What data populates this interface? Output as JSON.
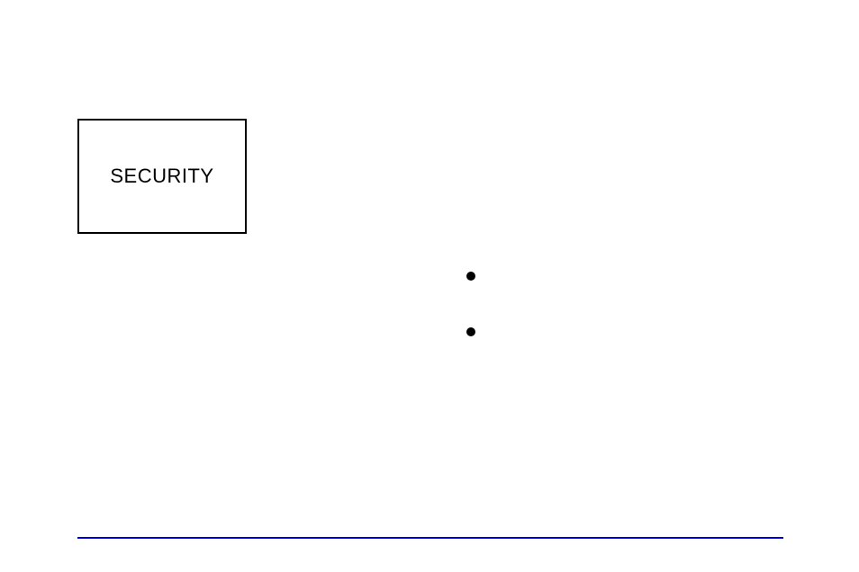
{
  "title_box": {
    "label": "SECURITY"
  },
  "bullets": {
    "item1": "",
    "item2": ""
  }
}
